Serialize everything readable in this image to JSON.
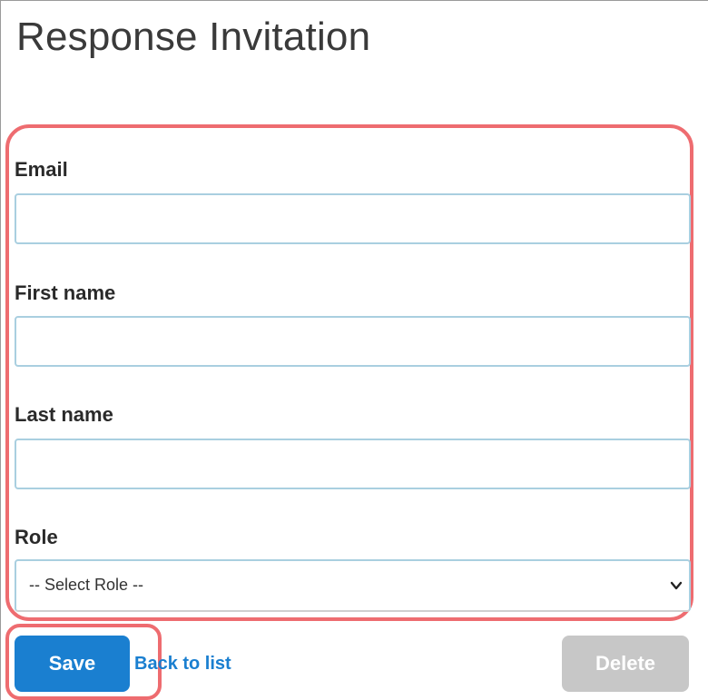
{
  "page": {
    "title": "Response Invitation"
  },
  "form": {
    "email": {
      "label": "Email",
      "value": ""
    },
    "first_name": {
      "label": "First name",
      "value": ""
    },
    "last_name": {
      "label": "Last name",
      "value": ""
    },
    "role": {
      "label": "Role",
      "selected": "-- Select Role --"
    }
  },
  "actions": {
    "save_label": "Save",
    "back_label": "Back to list",
    "delete_label": "Delete"
  },
  "colors": {
    "primary": "#1a7fd0",
    "highlight": "#ee6c70",
    "disabled": "#c7c7c7",
    "input_border": "#a9cfe0"
  }
}
